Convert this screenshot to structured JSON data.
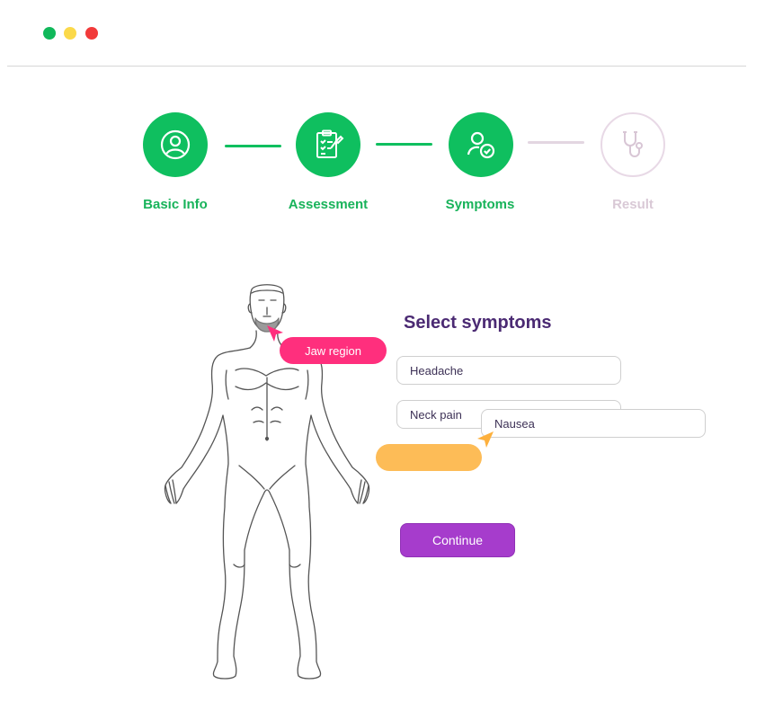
{
  "window": {
    "controls": [
      {
        "name": "green",
        "color": "#10b85a"
      },
      {
        "name": "yellow",
        "color": "#fbd94a"
      },
      {
        "name": "red",
        "color": "#f23a3a"
      }
    ]
  },
  "stepper": {
    "steps": [
      {
        "label": "Basic Info",
        "icon": "user-icon",
        "state": "complete"
      },
      {
        "label": "Assessment",
        "icon": "clipboard-icon",
        "state": "complete"
      },
      {
        "label": "Symptoms",
        "icon": "user-check-icon",
        "state": "current"
      },
      {
        "label": "Result",
        "icon": "stethoscope-icon",
        "state": "pending"
      }
    ],
    "colors": {
      "active": "#0fbf5f",
      "pending": "#e3d6e1"
    }
  },
  "main": {
    "title": "Select symptoms",
    "fields": [
      {
        "value": "Headache"
      },
      {
        "value": "Neck pain"
      },
      {
        "value": "Nausea"
      }
    ],
    "tags": [
      {
        "label": "Jaw region",
        "color": "#ff2f7d"
      },
      {
        "label": "",
        "color": "#fdbc57"
      }
    ],
    "continue_label": "Continue",
    "continue_color": "#a63ccc"
  }
}
